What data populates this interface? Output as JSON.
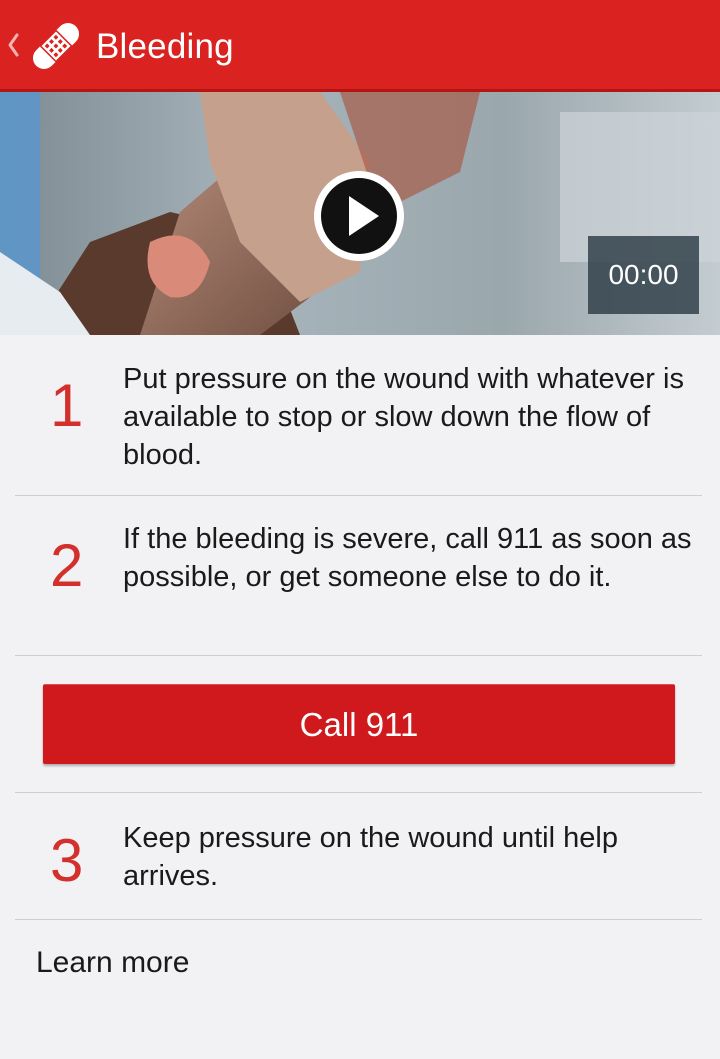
{
  "app_bar": {
    "title": "Bleeding",
    "back_icon": "chevron-left-icon",
    "app_icon": "bandage-icon",
    "color": "#da2320"
  },
  "video": {
    "timer": "00:00",
    "play_icon": "play-icon"
  },
  "steps": [
    {
      "number": "1",
      "text": "Put pressure on the wound with whatever is available to stop or slow down the flow of blood."
    },
    {
      "number": "2",
      "text": "If the bleeding is severe, call 911 as soon as possible, or get someone else to do it."
    },
    {
      "number": "3",
      "text": "Keep pressure on the wound until help arrives."
    }
  ],
  "call_button": {
    "label": "Call 911",
    "color": "#d0191c"
  },
  "learn_more": "Learn more"
}
